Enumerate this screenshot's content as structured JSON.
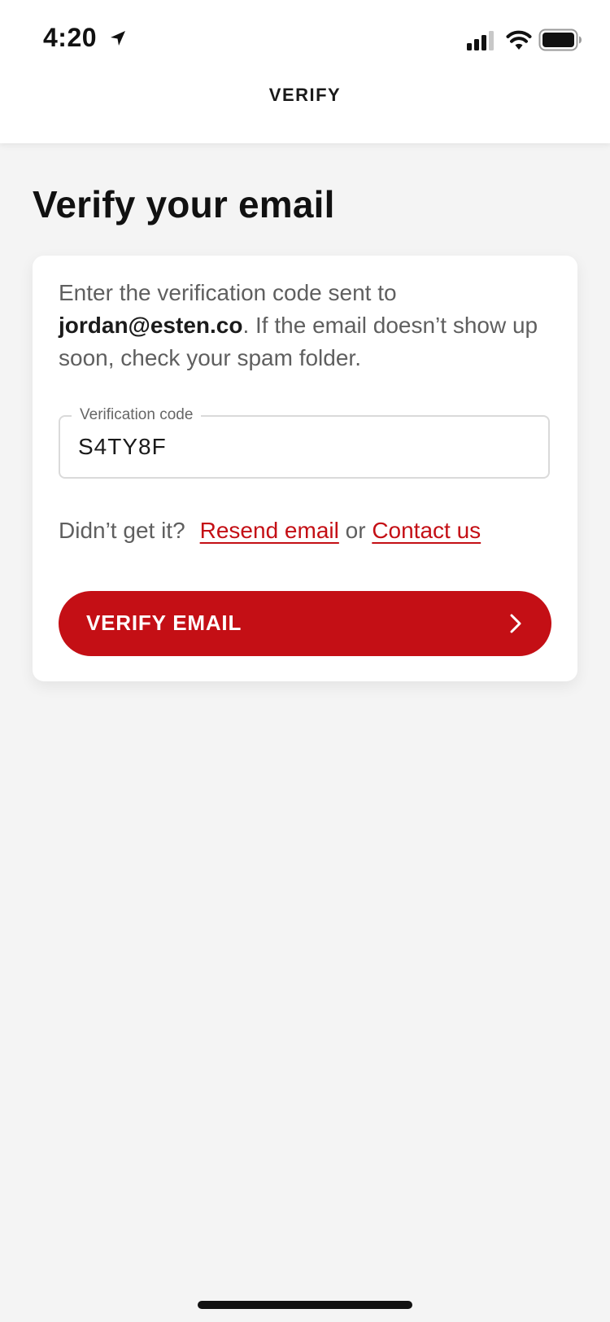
{
  "status_bar": {
    "time": "4:20",
    "icons": [
      "location-arrow-icon",
      "cellular-signal-icon",
      "wifi-icon",
      "battery-icon"
    ]
  },
  "nav": {
    "title": "VERIFY"
  },
  "page": {
    "title": "Verify your email"
  },
  "card": {
    "instruction_prefix": "Enter the verification code sent to ",
    "email": "jordan@esten.co",
    "instruction_suffix": ". If the email doesn’t show up soon, check your spam folder."
  },
  "code_field": {
    "label": "Verification code",
    "value": "S4TY8F"
  },
  "help": {
    "prompt": "Didn’t get it?",
    "resend_label": "Resend email",
    "connector": "or",
    "contact_label": "Contact us"
  },
  "verify_button": {
    "label": "VERIFY EMAIL",
    "icon": "chevron-right-icon"
  },
  "colors": {
    "accent": "#c40f15",
    "background": "#f4f4f4",
    "card": "#ffffff",
    "body_text": "#5f5f5f",
    "heading_text": "#111111"
  }
}
